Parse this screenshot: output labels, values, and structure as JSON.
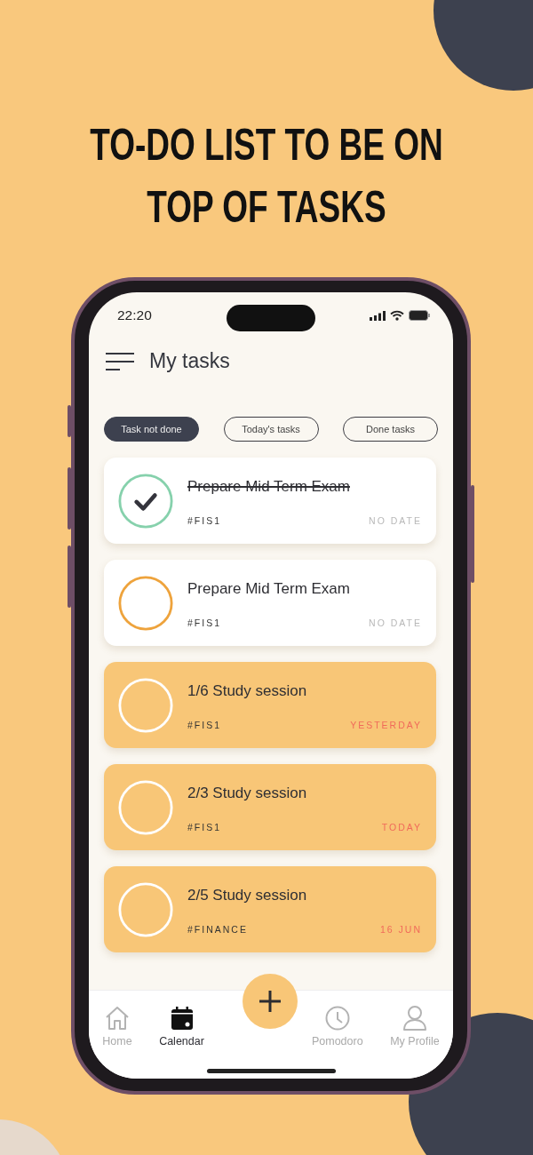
{
  "headline": "TO-DO LIST TO BE ON TOP OF TASKS",
  "status_bar": {
    "time": "22:20"
  },
  "header": {
    "title": "My tasks"
  },
  "filters": [
    {
      "label": "Task not done",
      "selected": true
    },
    {
      "label": "Today's tasks",
      "selected": false
    },
    {
      "label": "Done tasks",
      "selected": false
    }
  ],
  "tasks": [
    {
      "kind": "done",
      "title": "Prepare Mid Term Exam",
      "tag": "#FIS1",
      "date": "NO DATE"
    },
    {
      "kind": "open",
      "title": "Prepare Mid Term Exam",
      "tag": "#FIS1",
      "date": "NO DATE"
    },
    {
      "kind": "due",
      "title": "1/6 Study session",
      "tag": "#FIS1",
      "date": "YESTERDAY"
    },
    {
      "kind": "due",
      "title": "2/3 Study session",
      "tag": "#FIS1",
      "date": "TODAY"
    },
    {
      "kind": "due",
      "title": "2/5 Study session",
      "tag": "#FINANCE",
      "date": "16 JUN"
    }
  ],
  "tab_bar": [
    {
      "label": "Home",
      "selected": false
    },
    {
      "label": "Calendar",
      "selected": true
    },
    {
      "label": "Pomodoro",
      "selected": false
    },
    {
      "label": "My Profile",
      "selected": false
    }
  ]
}
